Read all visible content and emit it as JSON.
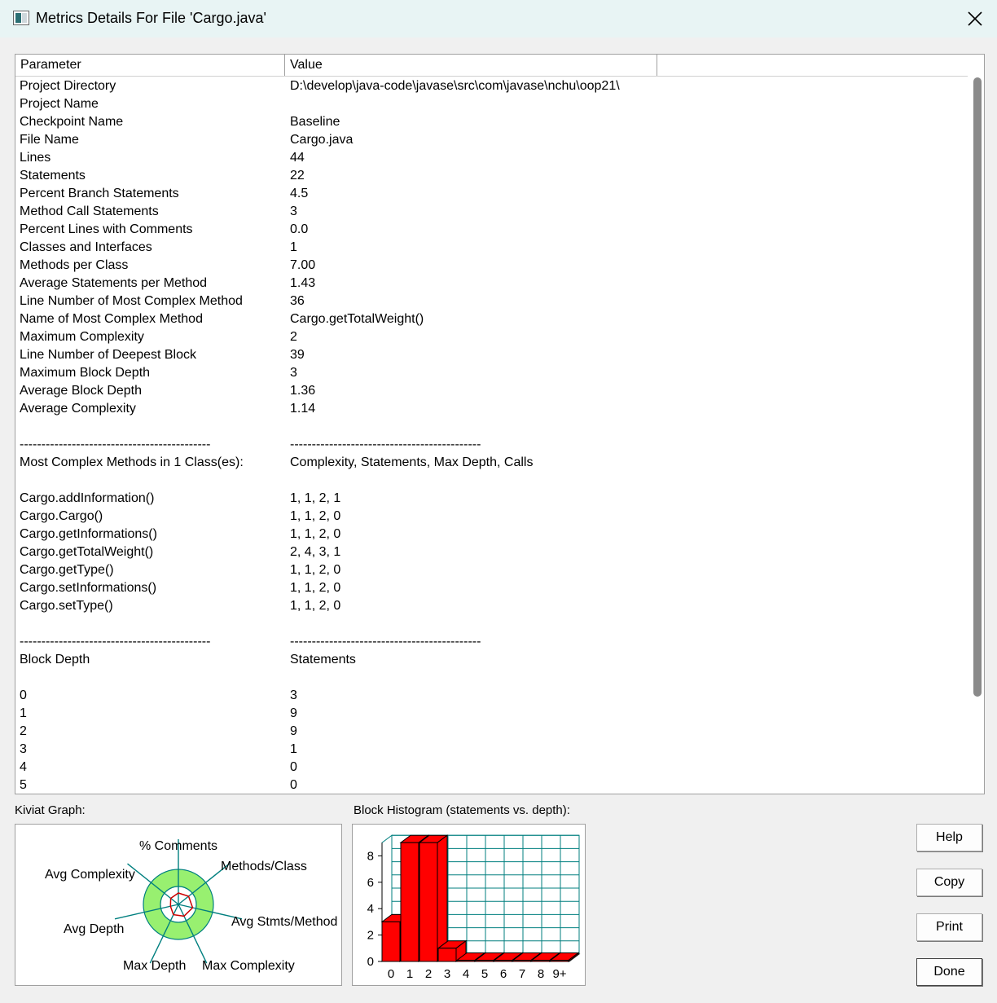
{
  "window": {
    "title": "Metrics Details For File 'Cargo.java'"
  },
  "table": {
    "columns": [
      "Parameter",
      "Value"
    ],
    "rows": [
      [
        "Project Directory",
        "D:\\develop\\java-code\\javase\\src\\com\\javase\\nchu\\oop21\\"
      ],
      [
        "Project Name",
        ""
      ],
      [
        "Checkpoint Name",
        "Baseline"
      ],
      [
        "File Name",
        "Cargo.java"
      ],
      [
        "Lines",
        "44"
      ],
      [
        "Statements",
        "22"
      ],
      [
        "Percent Branch Statements",
        "4.5"
      ],
      [
        "Method Call Statements",
        "3"
      ],
      [
        "Percent Lines with Comments",
        "0.0"
      ],
      [
        "Classes and Interfaces",
        "1"
      ],
      [
        "Methods per Class",
        "7.00"
      ],
      [
        "Average Statements per Method",
        "1.43"
      ],
      [
        "Line Number of Most Complex Method",
        "36"
      ],
      [
        "Name of Most Complex Method",
        "Cargo.getTotalWeight()"
      ],
      [
        "Maximum Complexity",
        "2"
      ],
      [
        "Line Number of Deepest Block",
        "39"
      ],
      [
        "Maximum Block Depth",
        "3"
      ],
      [
        "Average Block Depth",
        "1.36"
      ],
      [
        "Average Complexity",
        "1.14"
      ],
      [
        "",
        ""
      ],
      [
        "--------------------------------------------",
        "--------------------------------------------"
      ],
      [
        "Most Complex Methods in 1 Class(es):",
        "Complexity, Statements, Max Depth, Calls"
      ],
      [
        "",
        ""
      ],
      [
        "Cargo.addInformation()",
        "1, 1, 2, 1"
      ],
      [
        "Cargo.Cargo()",
        "1, 1, 2, 0"
      ],
      [
        "Cargo.getInformations()",
        "1, 1, 2, 0"
      ],
      [
        "Cargo.getTotalWeight()",
        "2, 4, 3, 1"
      ],
      [
        "Cargo.getType()",
        "1, 1, 2, 0"
      ],
      [
        "Cargo.setInformations()",
        "1, 1, 2, 0"
      ],
      [
        "Cargo.setType()",
        "1, 1, 2, 0"
      ],
      [
        "",
        ""
      ],
      [
        "--------------------------------------------",
        "--------------------------------------------"
      ],
      [
        "Block Depth",
        "Statements"
      ],
      [
        "",
        ""
      ],
      [
        "0",
        "3"
      ],
      [
        "1",
        "9"
      ],
      [
        "2",
        "9"
      ],
      [
        "3",
        "1"
      ],
      [
        "4",
        "0"
      ],
      [
        "5",
        "0"
      ]
    ]
  },
  "kiviat": {
    "label": "Kiviat Graph:",
    "axes": [
      "% Comments",
      "Methods/Class",
      "Avg Stmts/Method",
      "Max Complexity",
      "Max Depth",
      "Avg Depth",
      "Avg Complexity"
    ]
  },
  "histogram": {
    "label": "Block Histogram (statements vs. depth):"
  },
  "chart_data": {
    "type": "bar",
    "categories": [
      "0",
      "1",
      "2",
      "3",
      "4",
      "5",
      "6",
      "7",
      "8",
      "9+"
    ],
    "values": [
      3,
      9,
      9,
      1,
      0,
      0,
      0,
      0,
      0,
      0
    ],
    "title": "Block Histogram (statements vs. depth):",
    "xlabel": "",
    "ylabel": "",
    "yticks": [
      0,
      2,
      4,
      6,
      8
    ],
    "ylim": [
      0,
      9
    ],
    "grid": true,
    "bar_color": "#ff0000",
    "grid_color": "#007f7f"
  },
  "buttons": {
    "help": "Help",
    "copy": "Copy",
    "print": "Print",
    "done": "Done"
  }
}
